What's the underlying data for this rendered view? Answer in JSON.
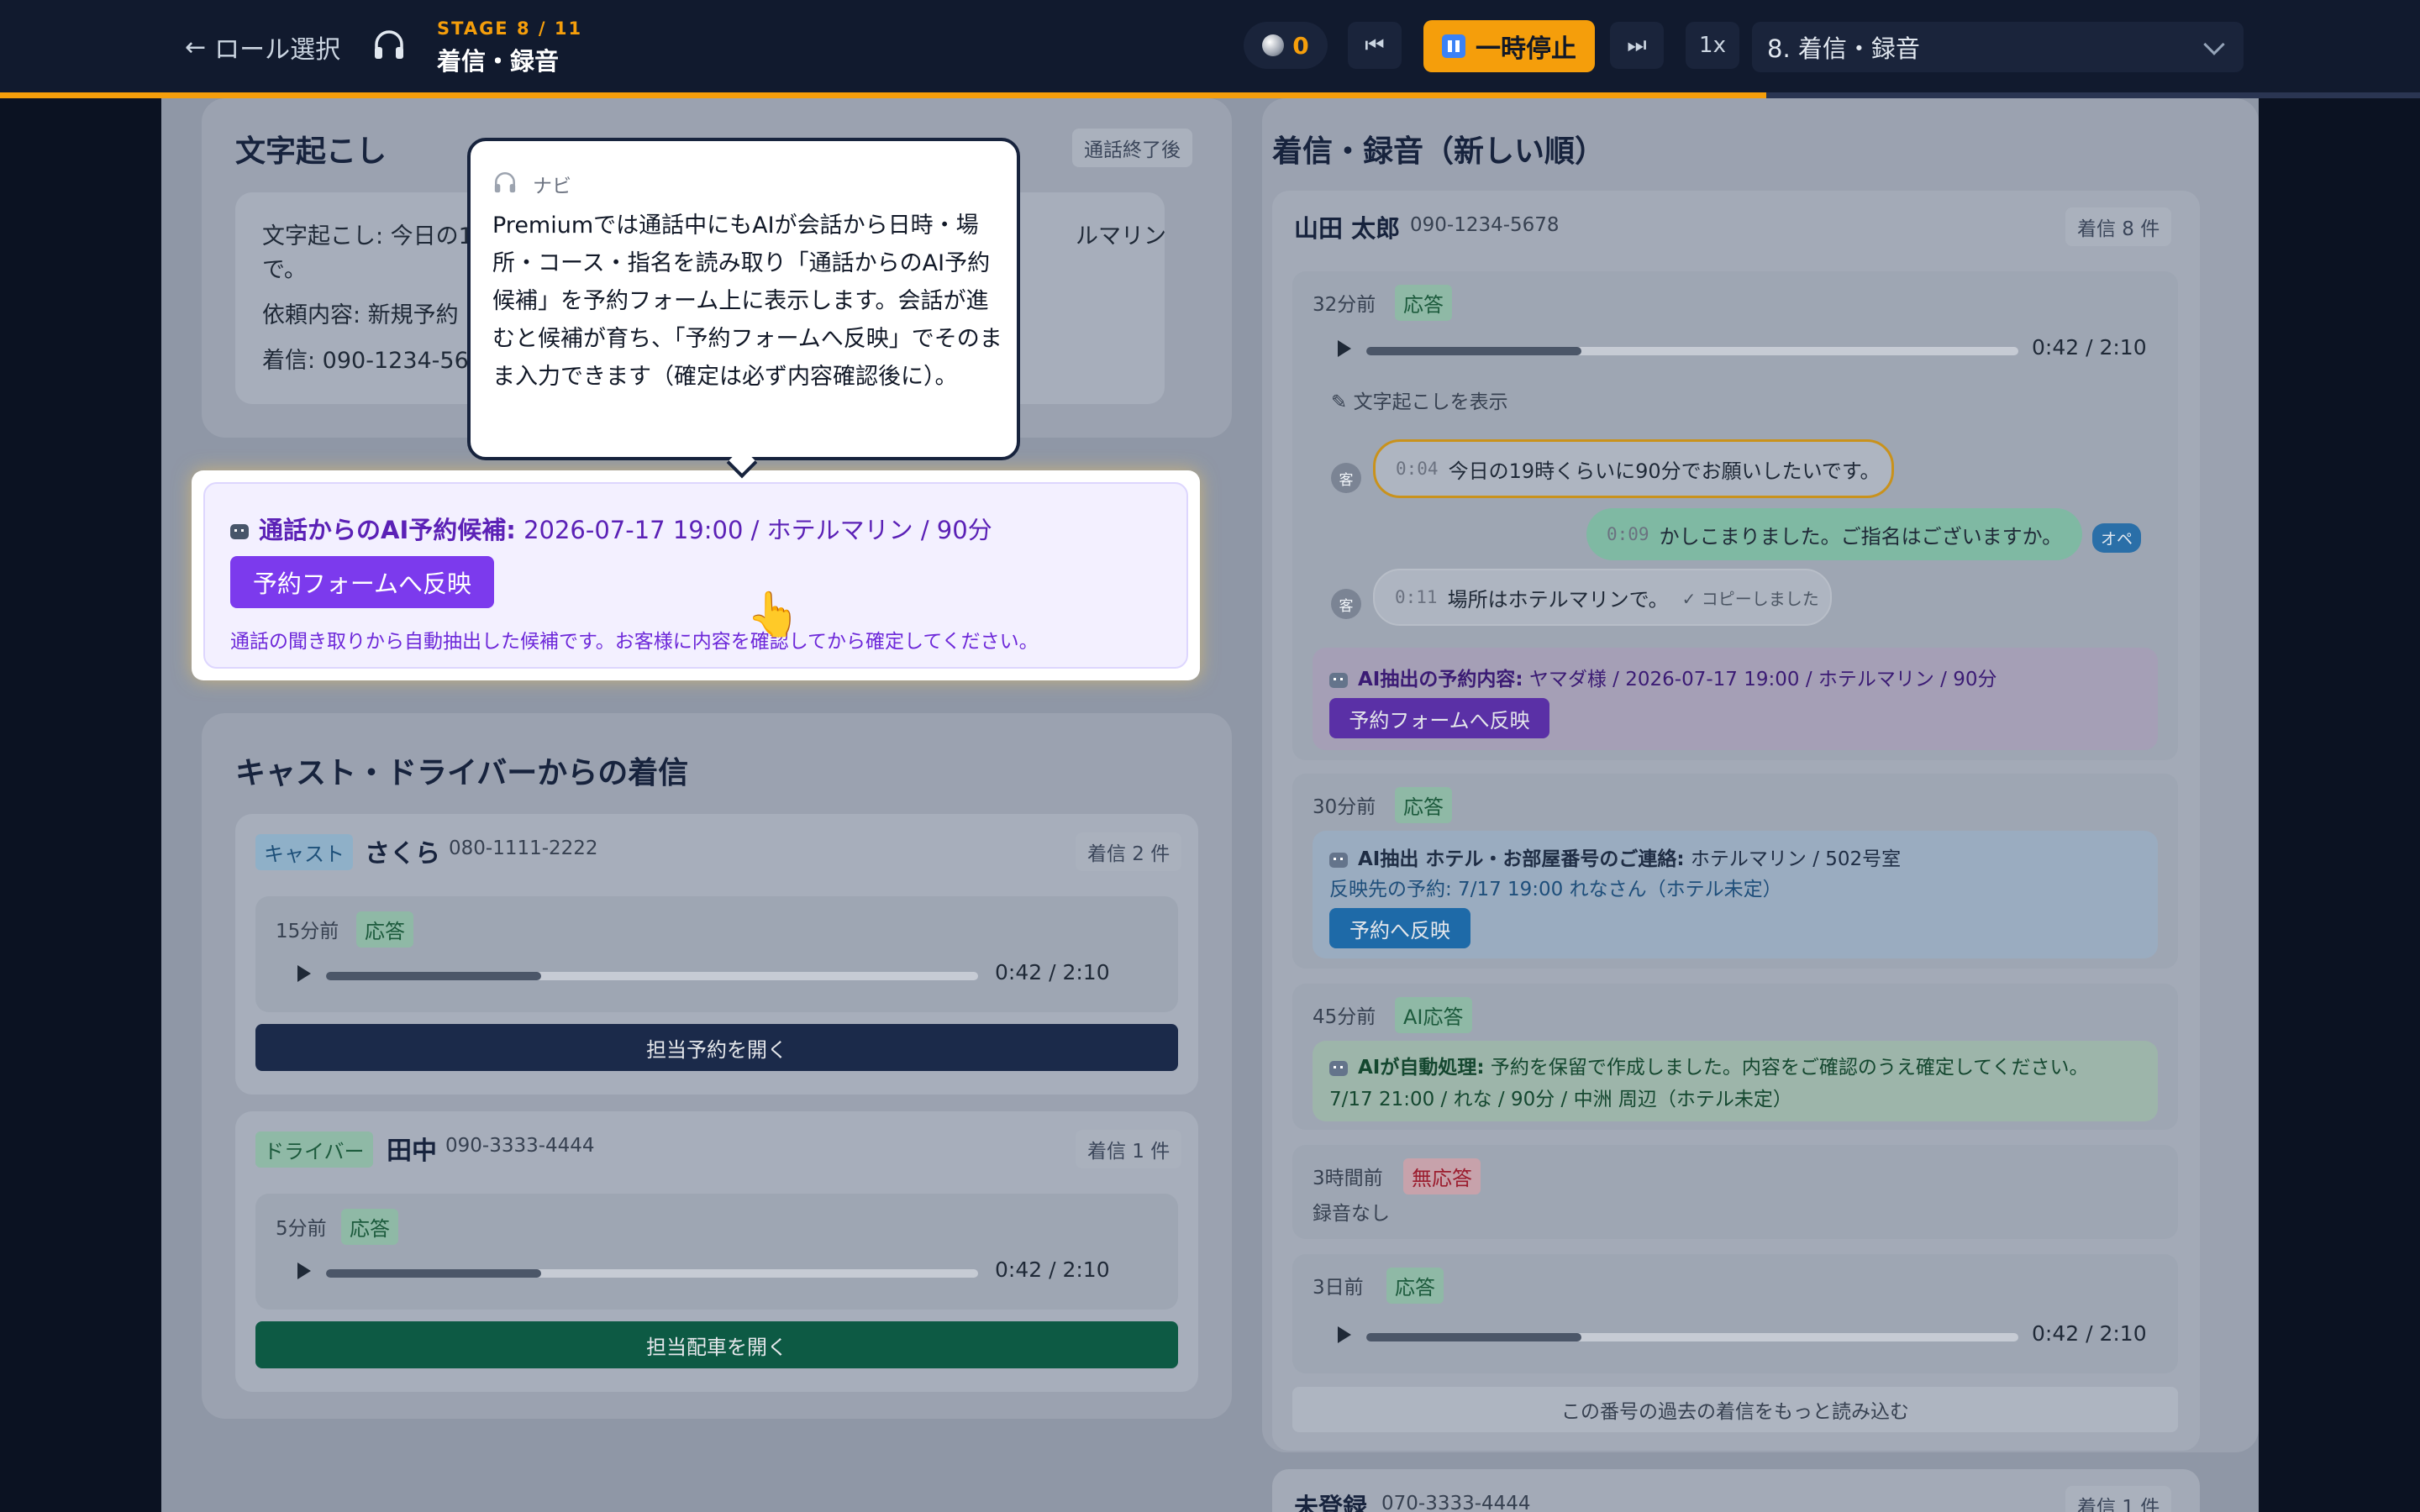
{
  "topbar": {
    "back_label": "ロール選択",
    "stage_label": "STAGE 8 / 11",
    "stage_title": "着信・録音",
    "coins": "0",
    "pause_label": "一時停止",
    "speed": "1x",
    "stage_select_value": "8. 着信・録音",
    "progress_fraction": 0.73
  },
  "left": {
    "transcript": {
      "title": "文字起こし",
      "badge": "通話終了後",
      "lines": [
        "文字起こし: 今日の19時くらいに90分でお願いしたいです。場所はホテルマリンで。",
        "依頼内容: 新規予約",
        "着信: 090-1234-5678"
      ],
      "line1a": "文字起こし: 今日の1",
      "line1b": "ルマリン",
      "line1c": "で。",
      "line2": "依頼内容: 新規予約",
      "line3": "着信: 090-1234-567"
    },
    "ai_candidate": {
      "label": "通話からのAI予約候補:",
      "value": "2026-07-17 19:00 / ホテルマリン / 90分",
      "button": "予約フォームへ反映",
      "note": "通話の聞き取りから自動抽出した候補です。お客様に内容を確認してから確定してください。"
    },
    "staff_calls": {
      "title": "キャスト・ドライバーからの着信",
      "cards": [
        {
          "role": "キャスト",
          "name": "さくら",
          "phone": "080-1111-2222",
          "count": "着信 2 件",
          "time": "15分前",
          "status": "応答",
          "playback": "0:42 / 2:10",
          "progress": 0.33,
          "button": "担当予約を開く"
        },
        {
          "role": "ドライバー",
          "name": "田中",
          "phone": "090-3333-4444",
          "count": "着信 1 件",
          "time": "5分前",
          "status": "応答",
          "playback": "0:42 / 2:10",
          "progress": 0.33,
          "button": "担当配車を開く"
        }
      ]
    }
  },
  "tooltip": {
    "header": "ナビ",
    "body": "Premiumでは通話中にもAIが会話から日時・場所・コース・指名を読み取り「通話からのAI予約候補」を予約フォーム上に表示します。会話が進むと候補が育ち、「予約フォームへ反映」でそのまま入力できます（確定は必ず内容確認後に）。"
  },
  "right": {
    "title": "着信・録音（新しい順）",
    "caller": {
      "name": "山田 太郎",
      "phone": "090-1234-5678",
      "count": "着信 8 件"
    },
    "calls": [
      {
        "time": "32分前",
        "status": "応答",
        "playback": "0:42 / 2:10",
        "progress": 0.33,
        "show_transcript": "文字起こしを表示",
        "messages": [
          {
            "speaker": "客",
            "ts": "0:04",
            "text": "今日の19時くらいに90分でお願いしたいです。"
          },
          {
            "speaker": "オペ",
            "ts": "0:09",
            "text": "かしこまりました。ご指名はございますか。"
          },
          {
            "speaker": "客",
            "ts": "0:11",
            "text": "場所はホテルマリンで。",
            "extra": "✓ コピーしました"
          }
        ],
        "ai_label": "AI抽出の予約内容:",
        "ai_value": "ヤマダ様 / 2026-07-17 19:00 / ホテルマリン / 90分",
        "button": "予約フォームへ反映"
      },
      {
        "time": "30分前",
        "status": "応答",
        "ai_label": "AI抽出 ホテル・お部屋番号のご連絡:",
        "ai_value": "ホテルマリン / 502号室",
        "target": "反映先の予約: 7/17 19:00 れなさん（ホテル未定）",
        "button": "予約へ反映"
      },
      {
        "time": "45分前",
        "status": "AI応答",
        "ai_label": "AIが自動処理:",
        "ai_value": "予約を保留で作成しました。内容をご確認のうえ確定してください。",
        "detail": "7/17 21:00 / れな / 90分 / 中洲 周辺（ホテル未定）"
      },
      {
        "time": "3時間前",
        "status": "無応答",
        "note": "録音なし"
      },
      {
        "time": "3日前",
        "status": "応答",
        "playback": "0:42 / 2:10",
        "progress": 0.33
      }
    ],
    "load_more": "この番号の過去の着信をもっと読み込む",
    "next_caller": {
      "name": "未登録",
      "phone": "070-3333-4444",
      "count": "着信 1 件"
    }
  },
  "colors": {
    "accent": "#f59e0b",
    "ai_purple": "#6d28d9",
    "navy": "#17233d",
    "green": "#065f46",
    "topbar": "#111a2e"
  }
}
